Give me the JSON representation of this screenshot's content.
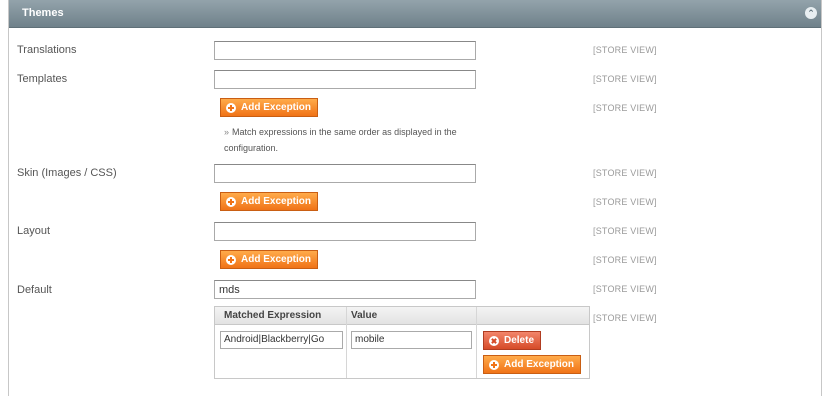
{
  "section": {
    "title": "Themes",
    "collapse_icon": "collapse-icon"
  },
  "scope_label": "[STORE VIEW]",
  "fields": {
    "translations": {
      "label": "Translations",
      "value": ""
    },
    "templates": {
      "label": "Templates",
      "value": ""
    },
    "skin": {
      "label": "Skin (Images / CSS)",
      "value": ""
    },
    "layout": {
      "label": "Layout",
      "value": ""
    },
    "default": {
      "label": "Default",
      "value": "mds"
    }
  },
  "add_exception_label": "Add Exception",
  "note": {
    "bullet": "»",
    "text": "Match expressions in the same order as displayed in the configuration."
  },
  "exception_table": {
    "columns": [
      "Matched Expression",
      "Value"
    ],
    "rows": [
      {
        "expression": "Android|Blackberry|Go",
        "value": "mobile"
      }
    ],
    "delete_label": "Delete",
    "add_label": "Add Exception"
  },
  "colors": {
    "header": "#7d8f98",
    "button_orange": "#f07317",
    "button_delete": "#d64b28",
    "scope_text": "#9a9a9a"
  }
}
